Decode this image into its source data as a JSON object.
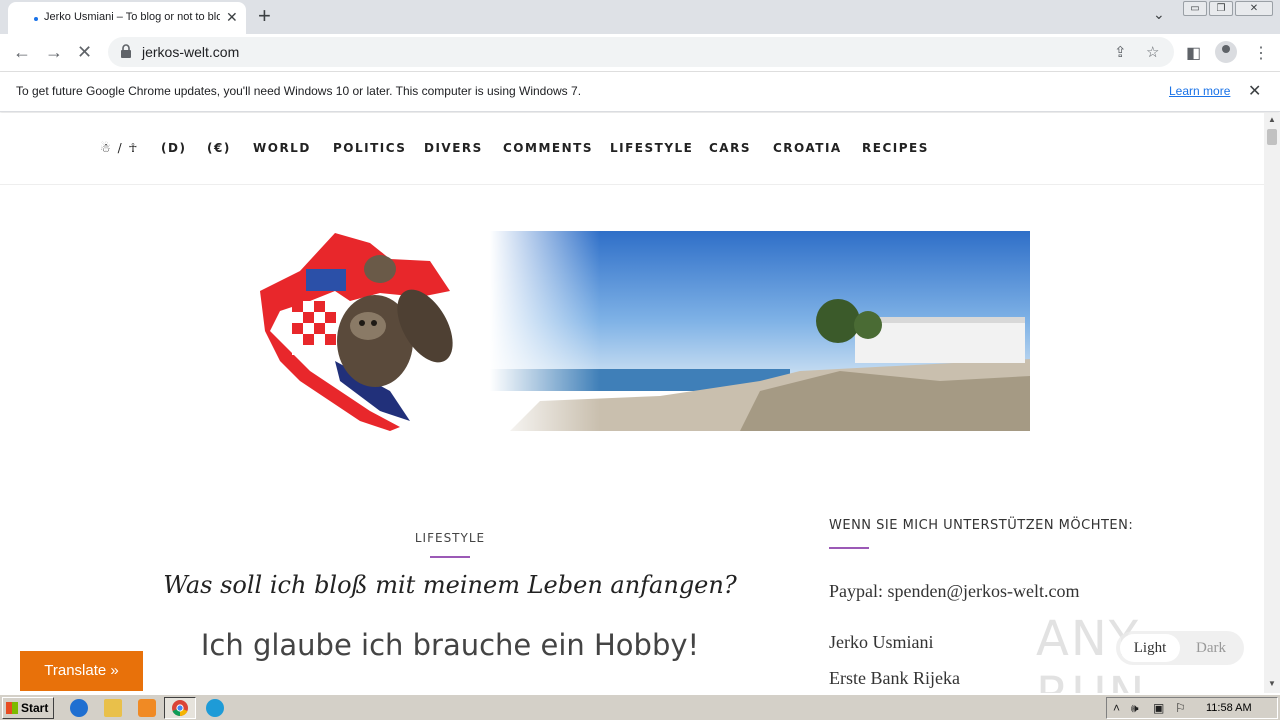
{
  "browser": {
    "tab_title": "Jerko Usmiani – To blog or not to blog",
    "url": "jerkos-welt.com",
    "infobar_text": "To get future Google Chrome updates, you'll need Windows 10 or later. This computer is using Windows 7.",
    "learn_more": "Learn more"
  },
  "site": {
    "nav": [
      "☃ / ☥",
      "(D)",
      "(€)",
      "WORLD",
      "POLITICS",
      "DIVERS",
      "COMMENTS",
      "LIFESTYLE",
      "CARS",
      "CROATIA",
      "RECIPES"
    ]
  },
  "post": {
    "category": "LIFESTYLE",
    "title": "Was soll ich bloß mit meinem Leben anfangen?",
    "subtitle": "Ich glaube ich brauche ein Hobby!"
  },
  "sidebar": {
    "heading": "WENN SIE MICH UNTERSTÜTZEN MÖCHTEN:",
    "paypal": "Paypal: spenden@jerkos-welt.com",
    "name": "Jerko Usmiani",
    "bank": "Erste Bank Rijeka"
  },
  "widgets": {
    "translate": "Translate »",
    "theme_light": "Light",
    "theme_dark": "Dark",
    "watermark": "ANY RUN"
  },
  "taskbar": {
    "start": "Start",
    "clock": "11:58 AM"
  },
  "colors": {
    "accent_purple": "#9b59b6",
    "translate_orange": "#e8710a",
    "chrome_blue": "#1a73e8"
  }
}
